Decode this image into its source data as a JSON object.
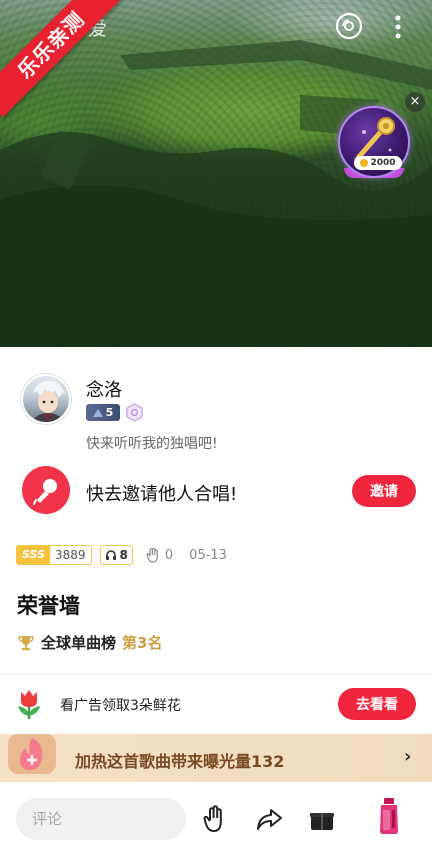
{
  "hero": {
    "title_fragment": "爱",
    "ribbon_text": "乐乐亲测",
    "gift_coins": "2000",
    "gift_close": "×"
  },
  "user": {
    "name": "念洛",
    "level": "5",
    "signature": "快来听听我的独唱吧!"
  },
  "invite": {
    "text": "快去邀请他人合唱!",
    "button": "邀请"
  },
  "stats": {
    "grade": "SSS",
    "score": "3889",
    "listeners": "8",
    "likes": "0",
    "date": "05-13"
  },
  "honor": {
    "title": "荣誉墙",
    "chart_label": "全球单曲榜",
    "rank": "第3名"
  },
  "ad": {
    "text": "看广告领取3朵鲜花",
    "button": "去看看"
  },
  "promo": {
    "text": "加热这首歌曲带来曝光量132",
    "chevron": "›"
  },
  "bottom": {
    "comment_placeholder": "评论"
  },
  "colors": {
    "accent": "#f0263d",
    "gold": "#c9a048",
    "promo_bg": "#f5e2c6",
    "promo_text": "#7a4a24"
  }
}
